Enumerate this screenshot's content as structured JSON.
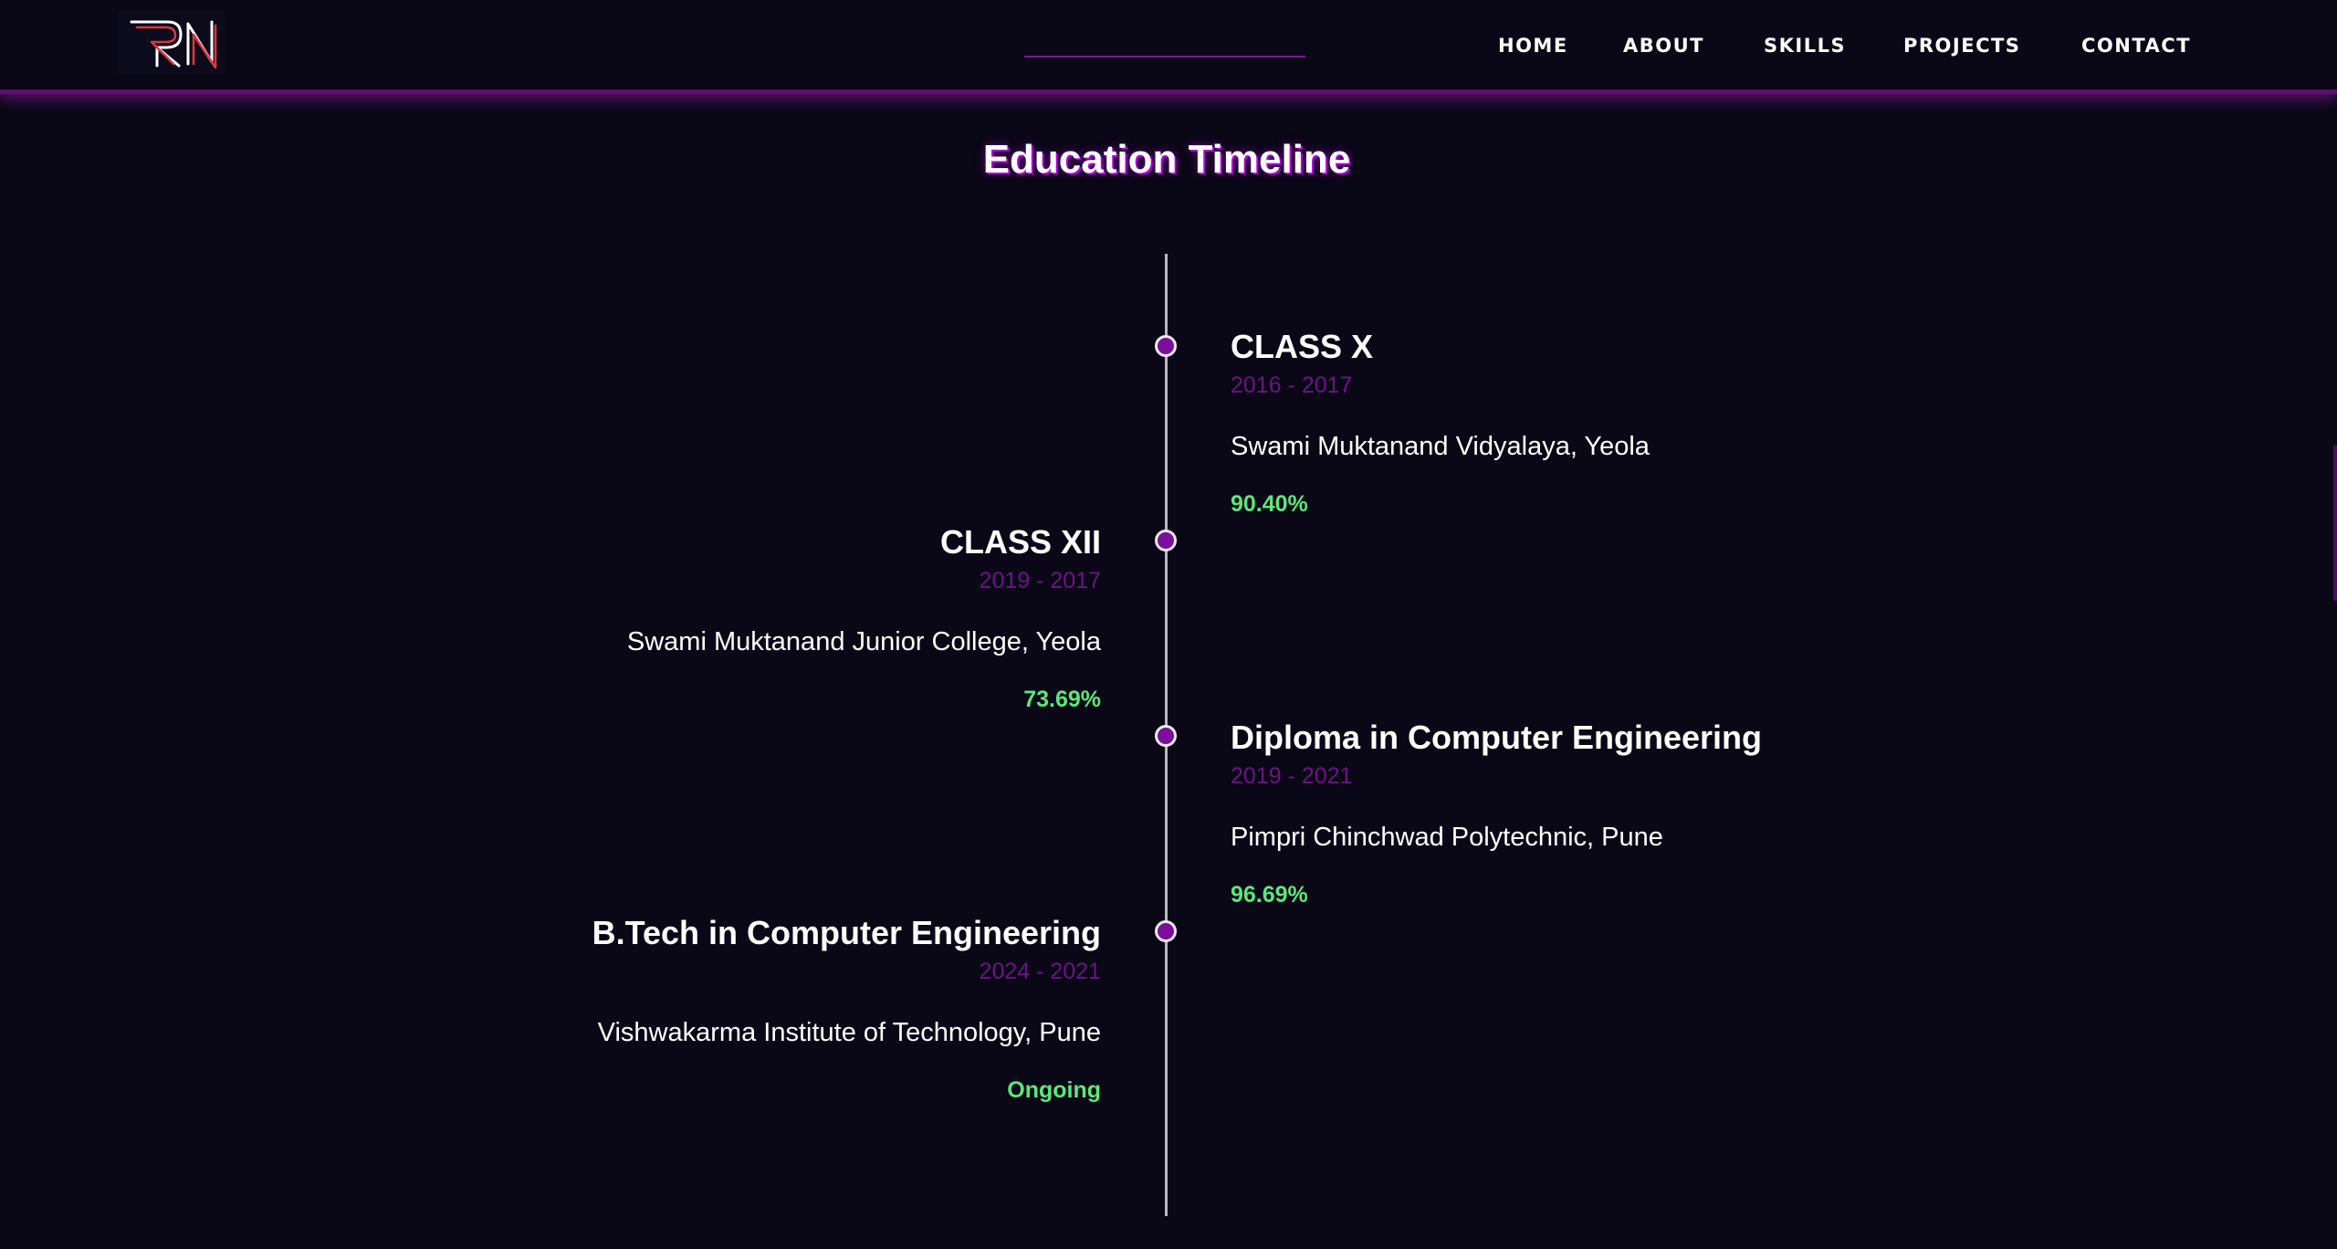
{
  "nav": {
    "links": [
      "HOME",
      "ABOUT",
      "SKILLS",
      "PROJECTS",
      "CONTACT"
    ]
  },
  "section": {
    "title": "Education Timeline"
  },
  "timeline": [
    {
      "side": "right",
      "title": "CLASS X",
      "years": "2016 - 2017",
      "school": "Swami Muktanand Vidyalaya, Yeola",
      "score": "90.40%"
    },
    {
      "side": "left",
      "title": "CLASS XII",
      "years": "2019 - 2017",
      "school": "Swami Muktanand Junior College, Yeola",
      "score": "73.69%"
    },
    {
      "side": "right",
      "title": "Diploma in Computer Engineering",
      "years": "2019 - 2021",
      "school": "Pimpri Chinchwad Polytechnic, Pune",
      "score": "96.69%"
    },
    {
      "side": "left",
      "title": "B.Tech in Computer Engineering",
      "years": "2024 - 2021",
      "school": "Vishwakarma Institute of Technology, Pune",
      "score": "Ongoing"
    }
  ],
  "colors": {
    "background": "#0a0716",
    "accent": "#7b0f9c",
    "years": "#6b1484",
    "score": "#5ae87a"
  }
}
